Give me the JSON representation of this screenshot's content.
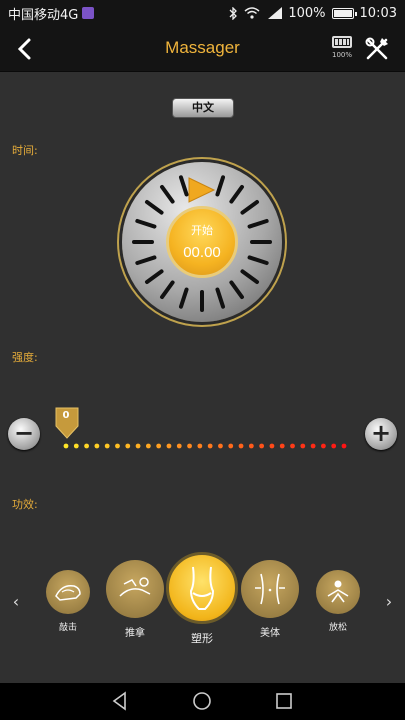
{
  "status_bar": {
    "carrier": "中国移动4G",
    "network": "4G",
    "battery": "100%",
    "time": "10:03"
  },
  "header": {
    "title": "Massager",
    "battery_label": "100%"
  },
  "language_button": "中文",
  "sections": {
    "time": "时间:",
    "intensity": "强度:",
    "function": "功效:"
  },
  "dial": {
    "start_label": "开始",
    "time_value": "00.00"
  },
  "intensity": {
    "value": "0",
    "level": 0,
    "max": 28
  },
  "functions": [
    {
      "label": "敲击",
      "icon": "tapping-icon"
    },
    {
      "label": "推拿",
      "icon": "massage-icon"
    },
    {
      "label": "塑形",
      "icon": "body-shaping-icon",
      "active": true
    },
    {
      "label": "美体",
      "icon": "body-beauty-icon"
    },
    {
      "label": "放松",
      "icon": "relax-icon"
    }
  ],
  "colors": {
    "accent": "#f0b43c",
    "background": "#303030",
    "header": "#141414"
  }
}
